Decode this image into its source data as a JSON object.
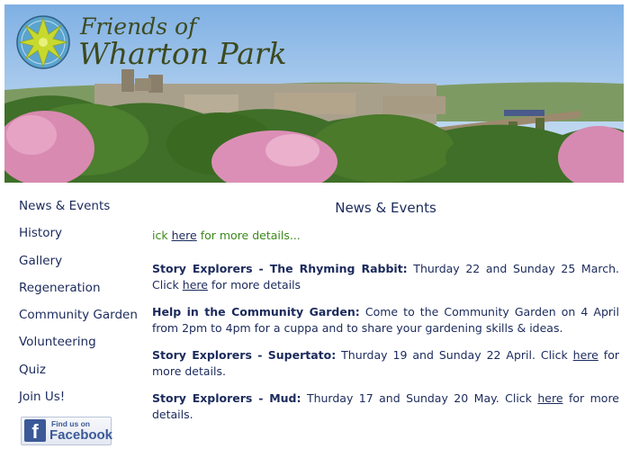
{
  "logo": {
    "line1": "Friends of",
    "line2": "Wharton Park"
  },
  "nav": [
    "News & Events",
    "History",
    "Gallery",
    "Regeneration",
    "Community Garden",
    "Volunteering",
    "Quiz",
    "Join Us!"
  ],
  "facebook": {
    "small": "Find us on",
    "big": "Facebook",
    "letter": "f"
  },
  "main": {
    "title": "News & Events",
    "ticker": {
      "before": "ick ",
      "link": "here",
      "after": " for more details..."
    },
    "items": [
      {
        "title": "Story Explorers - The Rhyming Rabbit:",
        "body": " Thurday 22 and Sunday 25 March. Click ",
        "link": "here",
        "tail": " for more details"
      },
      {
        "title": "Help in the Community Garden:",
        "body": " Come to the Community Garden on 4 April from 2pm to 4pm for a cuppa and to share your gardening skills & ideas.",
        "link": "",
        "tail": ""
      },
      {
        "title": "Story Explorers - Supertato:",
        "body": " Thurday 19 and Sunday 22 April. Click ",
        "link": "here",
        "tail": " for more details."
      },
      {
        "title": "Story Explorers - Mud:",
        "body": " Thurday 17 and Sunday 20 May. Click ",
        "link": "here",
        "tail": " for more details."
      }
    ]
  },
  "colors": {
    "nav_text": "#1b2a5c",
    "ticker": "#3a8a1a",
    "facebook": "#3b5998",
    "logo_star": "#c7d92e"
  }
}
